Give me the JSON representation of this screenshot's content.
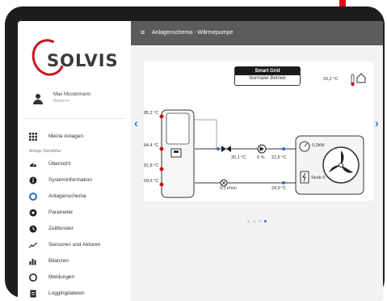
{
  "brand": {
    "name": "SOLVIS",
    "red": "#c4161c",
    "blue": "#2a6fb7"
  },
  "user": {
    "name": "Max Mustermann",
    "role": "Nutzer:in"
  },
  "sidebar": {
    "my_systems": "Meine Anlagen",
    "section": "Anlage SolvisMax",
    "items": [
      {
        "label": "Übersicht",
        "icon": "speedometer-icon"
      },
      {
        "label": "Systeminformation",
        "icon": "info-icon"
      },
      {
        "label": "Anlagenschema",
        "icon": "schema-icon"
      },
      {
        "label": "Parameter",
        "icon": "gear-icon"
      },
      {
        "label": "Zeitfenster",
        "icon": "clock-icon"
      },
      {
        "label": "Sensoren und Aktoren",
        "icon": "sensor-icon"
      },
      {
        "label": "Bilanzen",
        "icon": "bar-chart-icon"
      },
      {
        "label": "Meldungen",
        "icon": "bell-icon"
      },
      {
        "label": "Loggingdateien",
        "icon": "file-icon"
      }
    ]
  },
  "header": {
    "title": "Anlagenschema - Wärmepumpe"
  },
  "schema": {
    "smart_grid_title": "Smart Grid",
    "smart_grid_status": "Normaler Betrieb",
    "outdoor_temp": "20,2 °C",
    "tank_top": "85,2 °C",
    "tank_t2": "84,4 °C",
    "tank_t3": "81,8 °C",
    "tank_bottom": "68,6 °C",
    "flow_temp": "30,1 °C",
    "pump": "0 %",
    "hp_flow": "22,6 °C",
    "hp_return": "24,9 °C",
    "volume_flow": "0,0 l/min",
    "power": "0,0kW",
    "stage": "Stufe 0"
  },
  "pager": {
    "count": 4,
    "active": 3
  }
}
